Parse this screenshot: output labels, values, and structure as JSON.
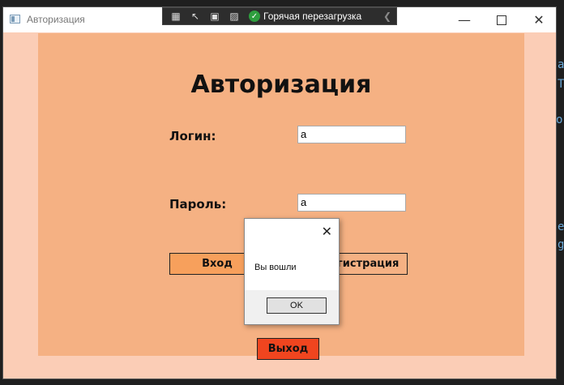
{
  "ide_background": {
    "fragments": [
      "a",
      "T",
      "o",
      "e",
      "g"
    ]
  },
  "window": {
    "title": "Авторизация",
    "minimize_icon": "minimize-icon",
    "maximize_icon": "maximize-icon",
    "close_icon": "close-icon"
  },
  "debug_toolbar": {
    "hot_reload_label": "Горячая перезагрузка"
  },
  "form": {
    "heading": "Авторизация",
    "login_label": "Логин:",
    "login_value": "a",
    "password_label": "Пароль:",
    "password_value": "a",
    "login_button": "Вход",
    "register_button": "Регистрация",
    "exit_button": "Выход"
  },
  "dialog": {
    "message": "Вы вошли",
    "ok_button": "OK"
  },
  "colors": {
    "window_bg": "#fbcdb6",
    "panel_bg": "#f5b183",
    "login_button": "#f7a05c",
    "register_button": "#f5b183",
    "exit_button": "#f0451f"
  }
}
